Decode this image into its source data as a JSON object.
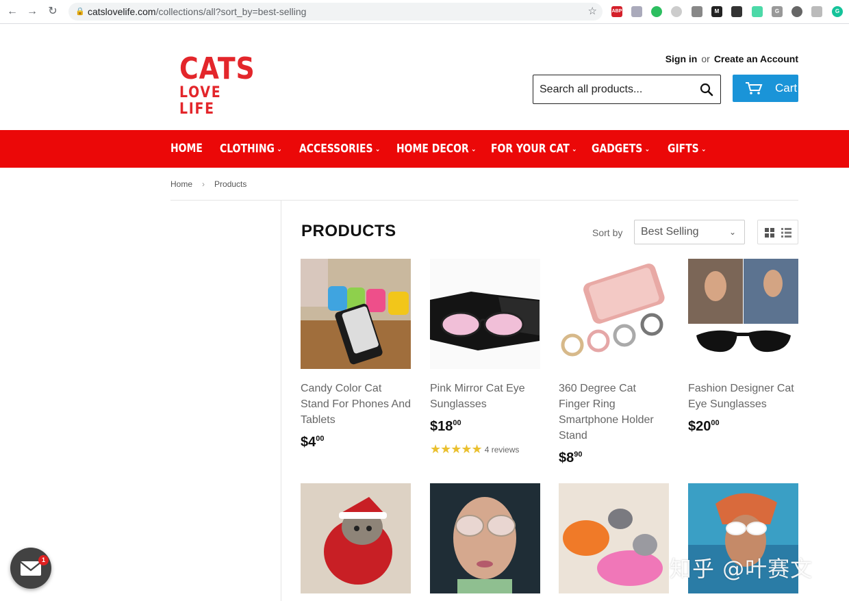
{
  "browser": {
    "url_host": "catslovelife.com",
    "url_path": "/collections/all?sort_by=best-selling",
    "extensions": [
      "ABP",
      "icon",
      "evernote-icon",
      "icon",
      "camera-icon",
      "M",
      "icon",
      "icon",
      "G",
      "robot-icon",
      "icon",
      "G"
    ]
  },
  "header": {
    "logo_line1": "CATS",
    "logo_line2": "LOVE LIFE",
    "sign_in": "Sign in",
    "or": "or",
    "create_account": "Create an Account",
    "search_placeholder": "Search all products...",
    "cart_label": "Cart"
  },
  "nav": {
    "items": [
      {
        "label": "HOME",
        "has_dropdown": false
      },
      {
        "label": "CLOTHING",
        "has_dropdown": true
      },
      {
        "label": "ACCESSORIES",
        "has_dropdown": true
      },
      {
        "label": "HOME DECOR",
        "has_dropdown": true
      },
      {
        "label": "FOR YOUR CAT",
        "has_dropdown": true
      },
      {
        "label": "GADGETS",
        "has_dropdown": true
      },
      {
        "label": "GIFTS",
        "has_dropdown": true
      }
    ]
  },
  "breadcrumb": {
    "home": "Home",
    "sep": "›",
    "current": "Products"
  },
  "collection": {
    "title": "PRODUCTS",
    "sort_label": "Sort by",
    "sort_value": "Best Selling"
  },
  "products": [
    {
      "name": "Candy Color Cat Stand For Phones And Tablets",
      "price_main": "$4",
      "price_cents": "00"
    },
    {
      "name": "Pink Mirror Cat Eye Sunglasses",
      "price_main": "$18",
      "price_cents": "00",
      "stars": "★★★★★",
      "reviews": "4 reviews"
    },
    {
      "name": "360 Degree Cat Finger Ring Smartphone Holder Stand",
      "price_main": "$8",
      "price_cents": "90"
    },
    {
      "name": "Fashion Designer Cat Eye Sunglasses",
      "price_main": "$20",
      "price_cents": "00"
    }
  ],
  "newsletter": {
    "badge_count": "1"
  },
  "watermark": "知乎 @叶赛文",
  "colors": {
    "brand_red": "#e3262b",
    "nav_red": "#eb0808",
    "cart_blue": "#1a94d8",
    "star_gold": "#eac02f"
  }
}
